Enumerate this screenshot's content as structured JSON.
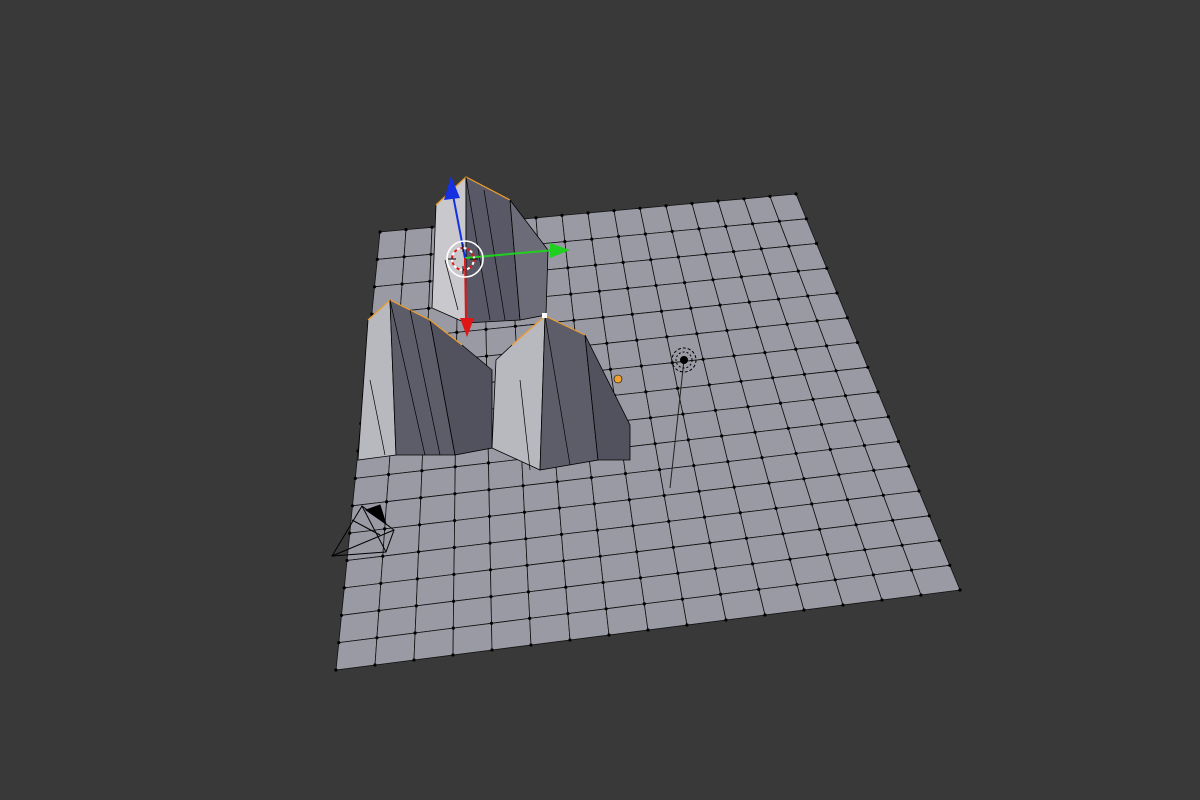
{
  "viewport": {
    "background": "#393939",
    "mode": "edit-mode",
    "objects": [
      "plane-mesh",
      "camera",
      "lamp",
      "3d-cursor",
      "transform-gizmo"
    ]
  },
  "mesh": {
    "face_color": "#9a9aa5",
    "edge_color": "#000000",
    "selected_color": "#f0a030",
    "ridge_face_colors": [
      "#4a4a55",
      "#565663",
      "#6f6f79",
      "#8f8f99",
      "#b3b3ba",
      "#c9c9cd"
    ],
    "peaks": 3
  },
  "gizmo": {
    "x_axis_color": "#e01515",
    "y_axis_color": "#20d020",
    "z_axis_color": "#1530e0",
    "pivot_ring_color": "#ffffff"
  },
  "cursor": {
    "ring_colors": [
      "#e01515",
      "#ffffff"
    ]
  },
  "lamp": {
    "ring_color": "#000000"
  },
  "camera": {
    "line_color": "#000000"
  }
}
